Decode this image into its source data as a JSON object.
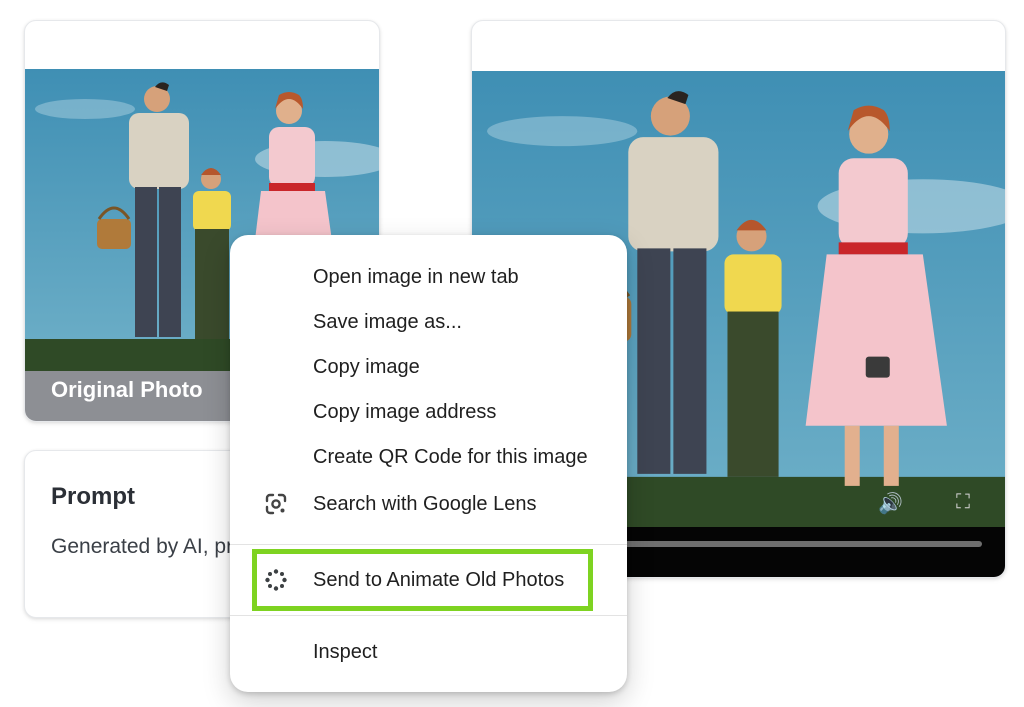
{
  "left_card": {
    "caption": "Original Photo"
  },
  "prompt_card": {
    "title": "Prompt",
    "body": "Generated by AI, provided."
  },
  "video_player": {
    "controls": {
      "volume_icon": "volume-icon",
      "fullscreen_icon": "fullscreen-icon"
    }
  },
  "context_menu": {
    "items": [
      {
        "label": "Open image in new tab"
      },
      {
        "label": "Save image as..."
      },
      {
        "label": "Copy image"
      },
      {
        "label": "Copy image address"
      },
      {
        "label": "Create QR Code for this image"
      },
      {
        "label": "Search with Google Lens",
        "icon": "google-lens-icon"
      },
      {
        "label": "Send to Animate Old Photos",
        "icon": "sparkle-icon"
      },
      {
        "label": "Inspect"
      }
    ],
    "highlight_color": "#7ED321"
  },
  "colors": {
    "sky": "#3f8fb4",
    "grass": "#2f4a26",
    "card_border": "#e6e8eb"
  }
}
